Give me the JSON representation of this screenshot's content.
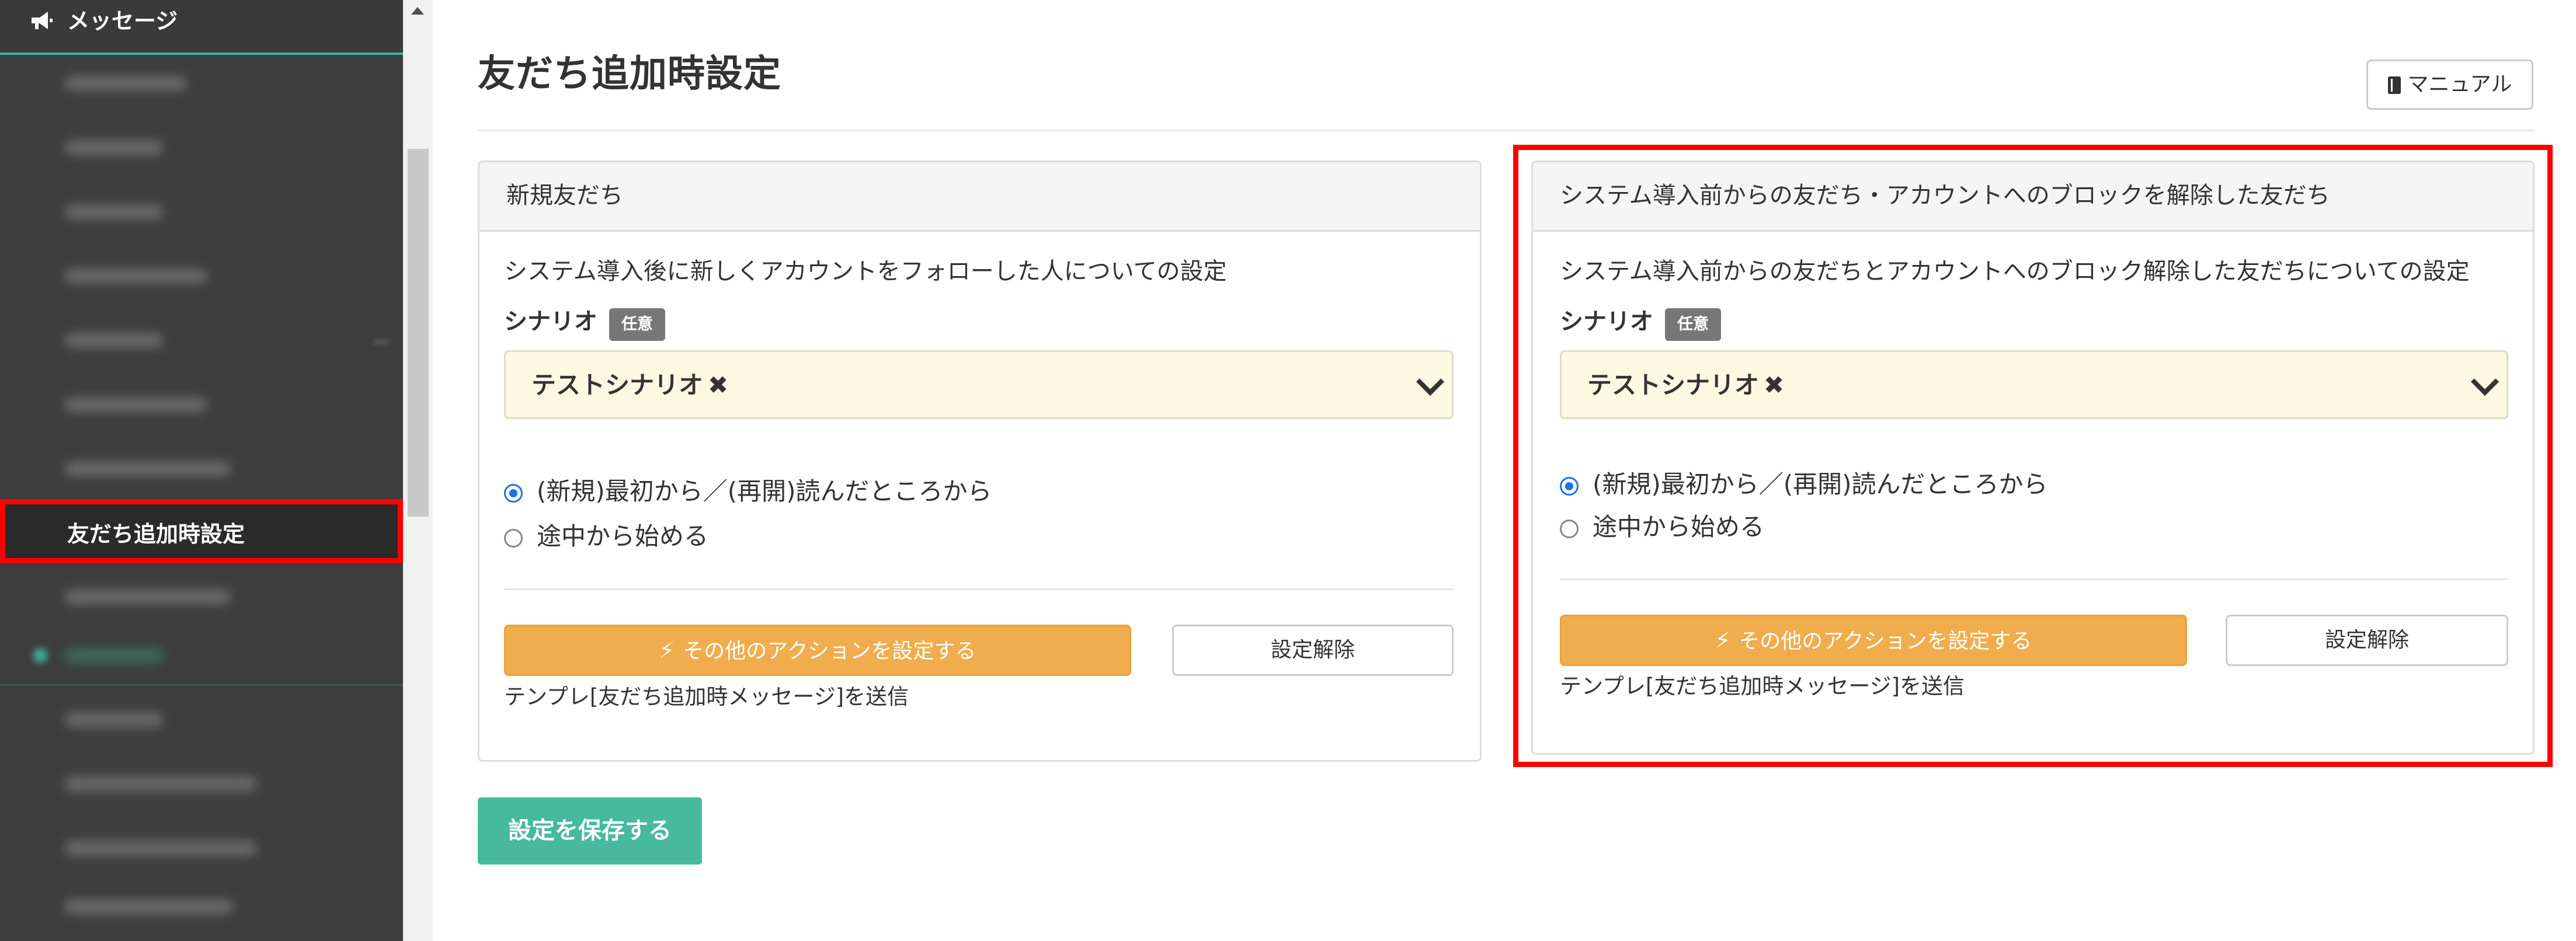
{
  "sidebar": {
    "header_label": "メッセージ",
    "active_item_label": "友だち追加時設定"
  },
  "main": {
    "page_title": "友だち追加時設定",
    "manual_label": "マニュアル",
    "save_label": "設定を保存する"
  },
  "panels": [
    {
      "title": "新規友だち",
      "description": "システム導入後に新しくアカウントをフォローした人についての設定",
      "scenario_label": "シナリオ",
      "scenario_badge": "任意",
      "scenario_value": "テストシナリオ",
      "radio_options": [
        "(新規)最初から／(再開)読んだところから",
        "途中から始める"
      ],
      "selected_option": 0,
      "action_label": "その他のアクションを設定する",
      "release_label": "設定解除",
      "template_note": "テンプレ[友だち追加時メッセージ]を送信"
    },
    {
      "title": "システム導入前からの友だち・アカウントへのブロックを解除した友だち",
      "description": "システム導入前からの友だちとアカウントへのブロック解除した友だちについての設定",
      "scenario_label": "シナリオ",
      "scenario_badge": "任意",
      "scenario_value": "テストシナリオ",
      "radio_options": [
        "(新規)最初から／(再開)読んだところから",
        "途中から始める"
      ],
      "selected_option": 0,
      "action_label": "その他のアクションを設定する",
      "release_label": "設定解除",
      "template_note": "テンプレ[友だち追加時メッセージ]を送信"
    }
  ],
  "colors": {
    "accent_green": "#47b99c",
    "action_orange": "#f0ad4e",
    "highlight_red": "#ff0000",
    "scenario_bg": "#fdf8e1"
  },
  "icons": {
    "header": "megaphone-icon",
    "manual": "book-icon",
    "action": "bolt-icon",
    "scenario_remove": "close-icon",
    "scenario_dropdown": "chevron-down-icon"
  }
}
